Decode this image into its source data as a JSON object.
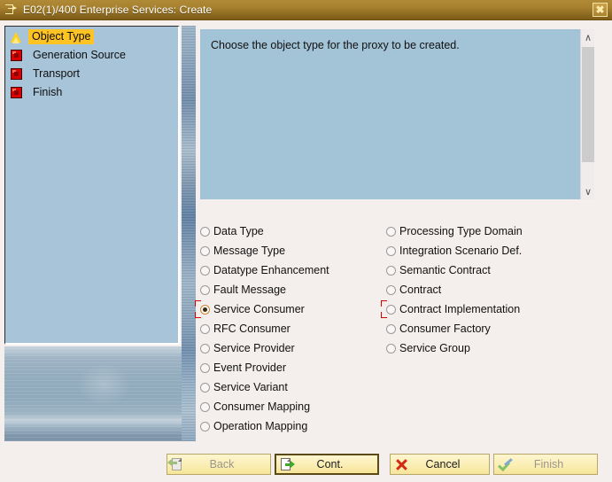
{
  "window": {
    "title": "E02(1)/400 Enterprise Services: Create",
    "title_icon": "create-object-icon",
    "close_label": "✖"
  },
  "sidebar": {
    "items": [
      {
        "label": "Object Type",
        "icon": "warning-triangle-icon",
        "state": "selected"
      },
      {
        "label": "Generation Source",
        "icon": "error-square-icon",
        "state": "pending"
      },
      {
        "label": "Transport",
        "icon": "error-square-icon",
        "state": "pending"
      },
      {
        "label": "Finish",
        "icon": "error-square-icon",
        "state": "pending"
      }
    ]
  },
  "instruction": {
    "text": "Choose the object type for the proxy to be created."
  },
  "scrollbar": {
    "up_glyph": "∧",
    "down_glyph": "∨"
  },
  "object_types": {
    "left_column": [
      {
        "label": "Data Type",
        "selected": false,
        "focused": false
      },
      {
        "label": "Message Type",
        "selected": false,
        "focused": false
      },
      {
        "label": "Datatype Enhancement",
        "selected": false,
        "focused": false
      },
      {
        "label": "Fault Message",
        "selected": false,
        "focused": false
      },
      {
        "label": "Service Consumer",
        "selected": true,
        "focused": true
      },
      {
        "label": "RFC Consumer",
        "selected": false,
        "focused": false
      },
      {
        "label": "Service Provider",
        "selected": false,
        "focused": false
      },
      {
        "label": "Event Provider",
        "selected": false,
        "focused": false
      },
      {
        "label": "Service Variant",
        "selected": false,
        "focused": false
      },
      {
        "label": "Consumer Mapping",
        "selected": false,
        "focused": false
      },
      {
        "label": "Operation Mapping",
        "selected": false,
        "focused": false
      }
    ],
    "right_column": [
      {
        "label": "Processing Type Domain",
        "selected": false,
        "focused": false
      },
      {
        "label": "Integration Scenario Def.",
        "selected": false,
        "focused": false
      },
      {
        "label": "Semantic Contract",
        "selected": false,
        "focused": false
      },
      {
        "label": "Contract",
        "selected": false,
        "focused": false
      },
      {
        "label": "Contract Implementation",
        "selected": false,
        "focused": true
      },
      {
        "label": "Consumer Factory",
        "selected": false,
        "focused": false
      },
      {
        "label": "Service Group",
        "selected": false,
        "focused": false
      }
    ]
  },
  "buttons": [
    {
      "label": "Back",
      "icon": "back-document-icon",
      "enabled": false,
      "focused": false
    },
    {
      "label": "Cont.",
      "icon": "forward-document-icon",
      "enabled": true,
      "focused": true
    },
    {
      "label": "Cancel",
      "icon": "red-x-icon",
      "enabled": true,
      "focused": false
    },
    {
      "label": "Finish",
      "icon": "check-pencil-icon",
      "enabled": false,
      "focused": false
    }
  ],
  "colors": {
    "titlebar": "#a8822f",
    "tree_panel": "#a8c4d8",
    "selected_row": "#ffc423",
    "instruction_panel": "#a3c3d6",
    "page_background": "#f4eeec",
    "button_face": "#fbeeb4",
    "focus_bracket": "#d40000"
  }
}
